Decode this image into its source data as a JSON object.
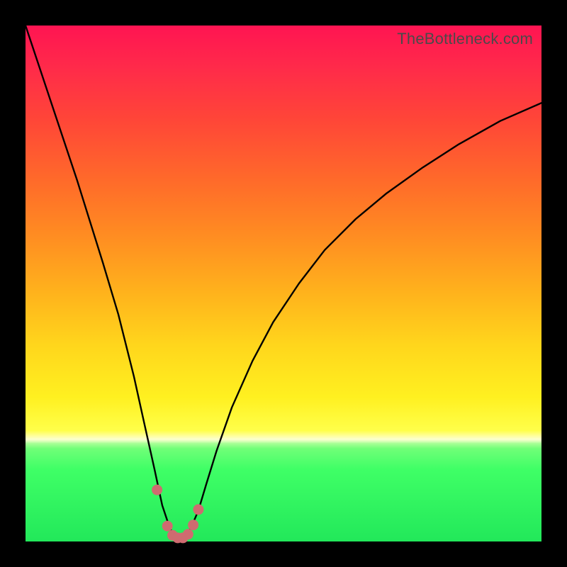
{
  "attribution": "TheBottleneck.com",
  "chart_data": {
    "type": "line",
    "title": "",
    "xlabel": "",
    "ylabel": "",
    "xlim": [
      0,
      100
    ],
    "ylim": [
      0,
      100
    ],
    "x": [
      0,
      5,
      10,
      15,
      18,
      21,
      23,
      25,
      26.5,
      28,
      29,
      30,
      31,
      32,
      33.5,
      35,
      37,
      40,
      44,
      48,
      53,
      58,
      64,
      70,
      77,
      84,
      92,
      100
    ],
    "values": [
      100,
      85,
      70,
      54,
      44,
      32,
      23,
      14,
      7,
      2.5,
      1,
      0.5,
      1,
      2.5,
      6,
      11,
      17.5,
      26,
      35,
      42.5,
      50,
      56.5,
      62.5,
      67.5,
      72.5,
      77,
      81.5,
      85
    ],
    "series_points": {
      "x": [
        25.5,
        27.5,
        28.5,
        29.5,
        30.5,
        31.5,
        32.5,
        33.5
      ],
      "y": [
        10,
        3,
        1.2,
        0.7,
        0.7,
        1.4,
        3.2,
        6.2
      ]
    },
    "colors": {
      "curve": "#000000",
      "points": "#cf6b70",
      "gradient_top": "#ff1452",
      "gradient_bottom": "#22e85a"
    },
    "annotations": []
  }
}
